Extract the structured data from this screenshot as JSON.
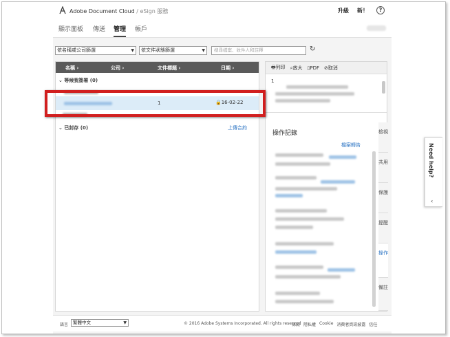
{
  "header": {
    "brand": "Adobe Document Cloud",
    "separator": "/",
    "service": "eSign 服務",
    "upgrade": "升級",
    "new": "新！",
    "help": "?"
  },
  "nav": {
    "tabs": [
      {
        "label": "顯示面板"
      },
      {
        "label": "傳送"
      },
      {
        "label": "管理"
      },
      {
        "label": "帳戶"
      }
    ]
  },
  "filters": {
    "name_filter": "依名稱或公司篩選",
    "status_filter": "依文件狀態篩選",
    "search_placeholder": "搜尋檔案、收件人和註釋"
  },
  "list": {
    "columns": [
      {
        "label": "名稱"
      },
      {
        "label": "公司"
      },
      {
        "label": "文件標題"
      },
      {
        "label": "日期"
      }
    ],
    "sections": {
      "waiting": "等候我簽署 (0)",
      "archived_section": "已封存 (0)",
      "upload_link": "上傳合約"
    },
    "selected_row": {
      "title": "1",
      "date": "16-02-22"
    }
  },
  "detail": {
    "toolbar": {
      "print": "列印",
      "zoom": "放大",
      "pdf": "PDF",
      "cancel": "取消"
    },
    "preview_line": "1",
    "activity_title": "操作記錄",
    "activity_link": "檔案轉告",
    "vtabs": [
      {
        "label": "檢視"
      },
      {
        "label": "共用"
      },
      {
        "label": "保護"
      },
      {
        "label": "提醒"
      },
      {
        "label": "操作"
      },
      {
        "label": "備註"
      }
    ]
  },
  "need_help": "Need help?",
  "footer": {
    "language_label": "語言",
    "language_value": "繁體中文",
    "copyright": "© 2016 Adobe Systems Incorporated. All rights reserved",
    "links": [
      {
        "label": "條款"
      },
      {
        "label": "隱私權"
      },
      {
        "label": "Cookie"
      },
      {
        "label": "消費者資訊披露"
      },
      {
        "label": "信任"
      }
    ]
  },
  "colors": {
    "accent": "#2d75c4",
    "highlight": "#d11f1f",
    "header_bg": "#5a5a5a",
    "selected_row": "#dcecf8"
  }
}
